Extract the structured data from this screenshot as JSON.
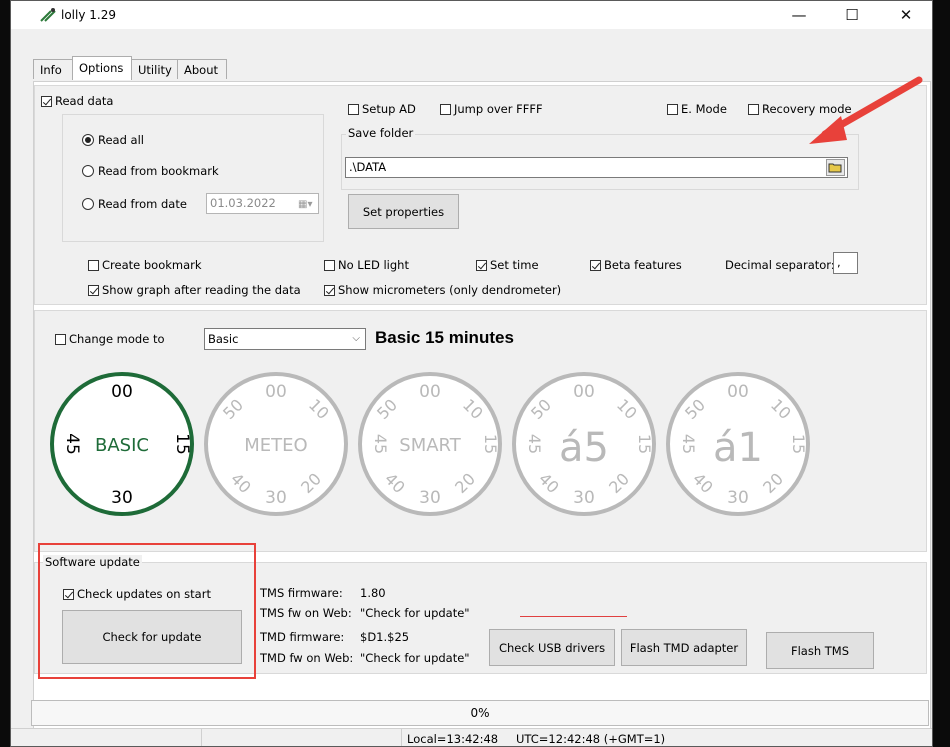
{
  "window": {
    "title": "lolly 1.29",
    "minimize": "—",
    "maximize": "☐",
    "close": "✕"
  },
  "tabs": [
    {
      "label": "Info",
      "active": false
    },
    {
      "label": "Options",
      "active": true
    },
    {
      "label": "Utility",
      "active": false
    },
    {
      "label": "About",
      "active": false
    }
  ],
  "read": {
    "read_data": {
      "label": "Read data",
      "checked": true
    },
    "read_all": {
      "label": "Read all",
      "selected": true
    },
    "read_from_bookmark": {
      "label": "Read from bookmark",
      "selected": false
    },
    "read_from_date": {
      "label": "Read from date",
      "selected": false
    },
    "date_value": "01.03.2022"
  },
  "top_options": {
    "setup_ad": {
      "label": "Setup AD",
      "checked": false
    },
    "jump_over": {
      "label": "Jump over FFFF",
      "checked": false
    },
    "e_mode": {
      "label": "E. Mode",
      "checked": false
    },
    "recovery_mode": {
      "label": "Recovery mode",
      "checked": false
    }
  },
  "save_folder": {
    "legend": "Save folder",
    "value": ".\\DATA"
  },
  "set_properties": "Set properties",
  "flags": {
    "create_bookmark": {
      "label": "Create bookmark",
      "checked": false
    },
    "no_led": {
      "label": "No LED light",
      "checked": false
    },
    "set_time": {
      "label": "Set time",
      "checked": true
    },
    "beta_features": {
      "label": "Beta features",
      "checked": true
    },
    "decimal_separator_label": "Decimal separator:",
    "decimal_separator_value": ",",
    "show_graph": {
      "label": "Show graph after reading the data",
      "checked": true
    },
    "show_micrometers": {
      "label": "Show micrometers (only dendrometer)",
      "checked": true
    }
  },
  "mode": {
    "change_mode": {
      "label": "Change mode to",
      "checked": false
    },
    "selected": "Basic",
    "heading": "Basic 15 minutes"
  },
  "dials": [
    {
      "name": "BASIC",
      "active": true,
      "top": "00",
      "right": "15",
      "bottom": "30",
      "left": "45"
    },
    {
      "name": "METEO",
      "active": false,
      "top": "00",
      "tl": "50",
      "tr": "10",
      "bl": "40",
      "br": "20",
      "bottom": "30"
    },
    {
      "name": "SMART",
      "active": false,
      "top": "00",
      "tl": "50",
      "tr": "10",
      "bl": "40",
      "br": "20",
      "bottom": "30",
      "left": "45",
      "right": "15"
    },
    {
      "name": "á5",
      "active": false,
      "top": "00",
      "tl": "50",
      "tr": "10",
      "bl": "40",
      "br": "20",
      "bottom": "30",
      "left": "45",
      "right": "15"
    },
    {
      "name": "á1",
      "active": false,
      "top": "00",
      "tl": "50",
      "tr": "10",
      "bl": "40",
      "br": "20",
      "bottom": "30",
      "left": "45",
      "right": "15"
    }
  ],
  "software_update": {
    "legend": "Software update",
    "check_on_start": {
      "label": "Check updates on start",
      "checked": true
    },
    "check_button": "Check for update"
  },
  "firmware": {
    "tms_fw_label": "TMS firmware:",
    "tms_fw_value": "1.80",
    "tms_web_label": "TMS fw on Web:",
    "tms_web_value": "\"Check for update\"",
    "tmd_fw_label": "TMD firmware:",
    "tmd_fw_value": "$D1.$25",
    "tmd_web_label": "TMD fw on Web:",
    "tmd_web_value": "\"Check for update\""
  },
  "buttons": {
    "check_usb": "Check USB drivers",
    "flash_tmd": "Flash TMD adapter",
    "flash_tms": "Flash TMS"
  },
  "progress": {
    "text": "0%",
    "value": 0
  },
  "status": {
    "local": "Local=13:42:48",
    "utc": "UTC=12:42:48 (+GMT=1)"
  },
  "colors": {
    "active_dial": "#1e6b38",
    "inactive_dial": "#b9b9b9",
    "annotation": "#e8413a"
  }
}
